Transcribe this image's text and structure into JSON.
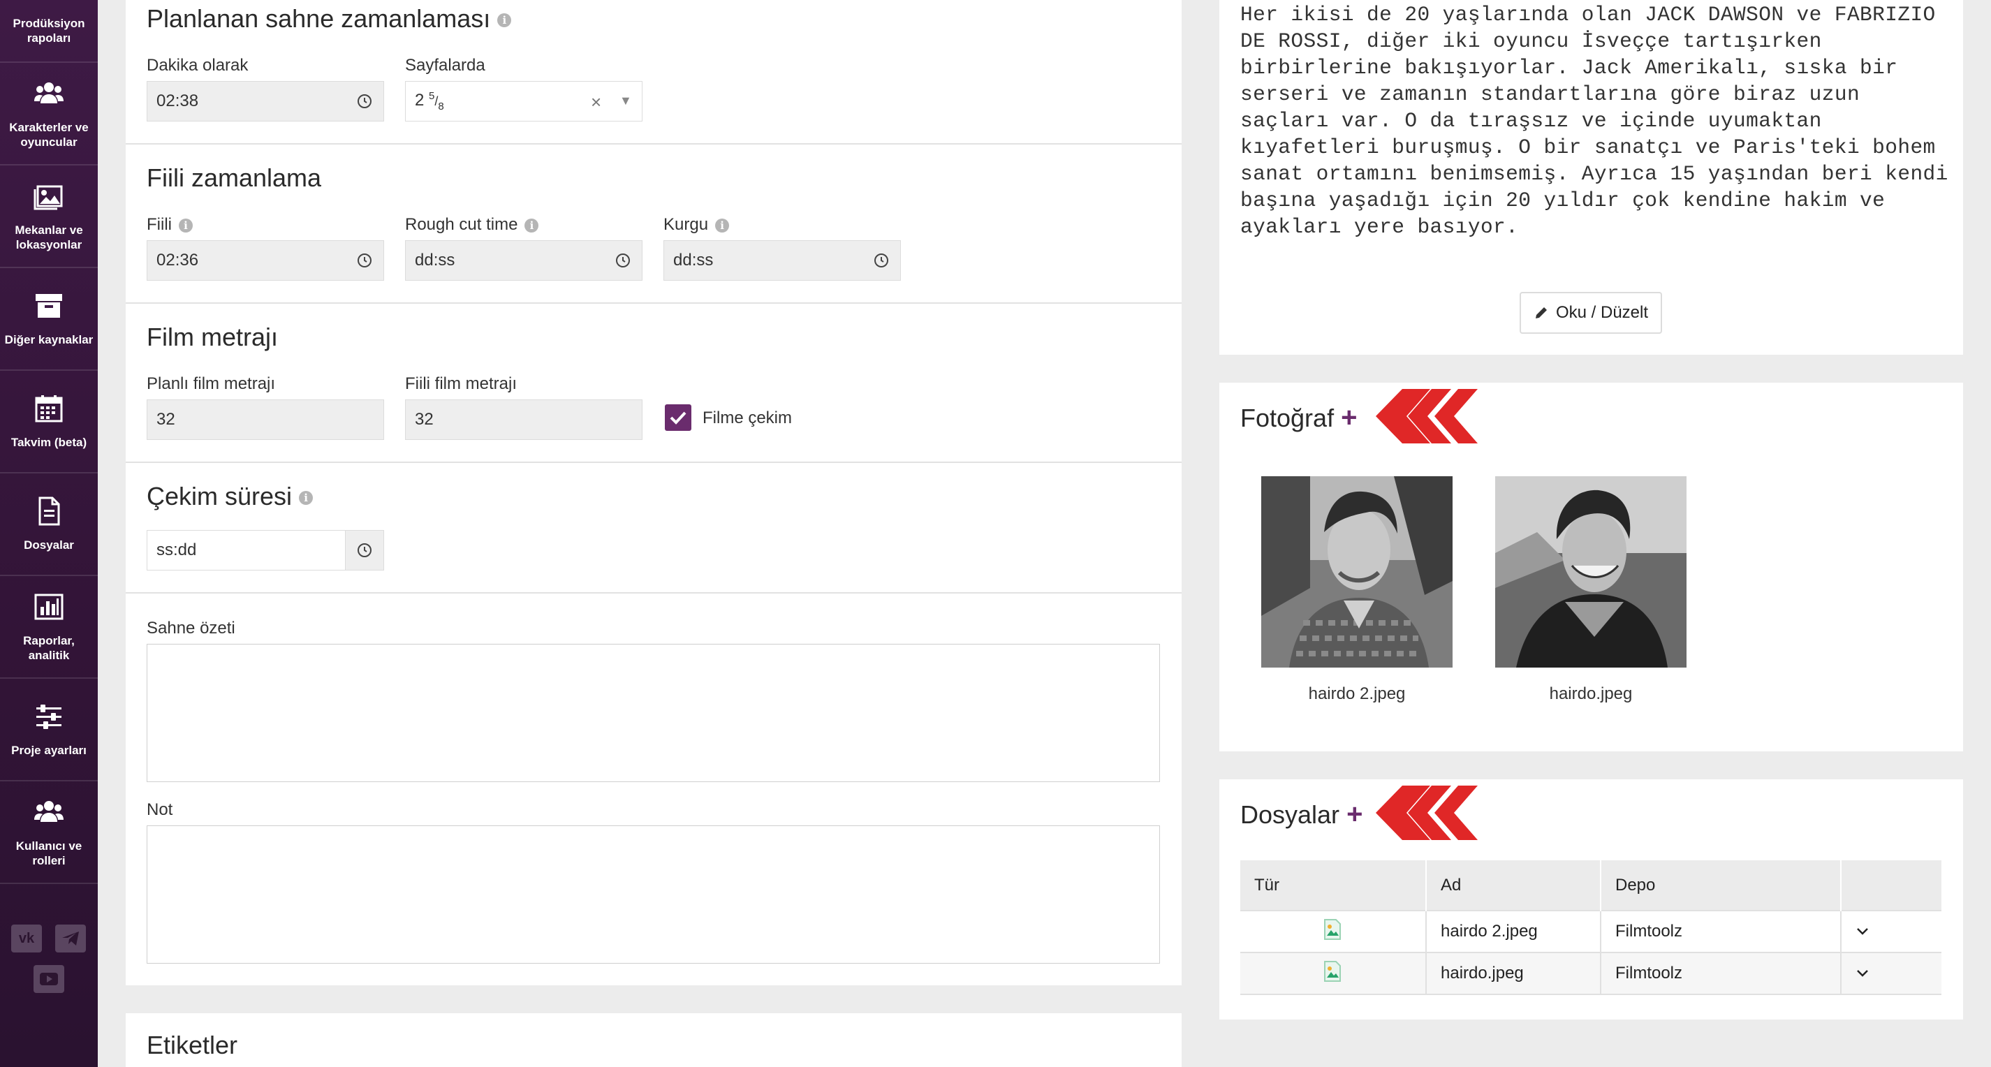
{
  "sidebar": {
    "items": [
      {
        "label": "Prodüksiyon rapoları",
        "icon": "none"
      },
      {
        "label": "Karakterler ve oyuncular",
        "icon": "users-icon"
      },
      {
        "label": "Mekanlar ve lokasyonlar",
        "icon": "image-icon"
      },
      {
        "label": "Diğer kaynaklar",
        "icon": "archive-icon"
      },
      {
        "label": "Takvim (beta)",
        "icon": "calendar-icon"
      },
      {
        "label": "Dosyalar",
        "icon": "file-icon"
      },
      {
        "label": "Raporlar, analitik",
        "icon": "bar-chart-icon"
      },
      {
        "label": "Proje ayarları",
        "icon": "sliders-icon"
      },
      {
        "label": "Kullanıcı ve rolleri",
        "icon": "users-icon"
      }
    ],
    "social": [
      "VK",
      "telegram",
      "youtube"
    ]
  },
  "planned": {
    "title": "Planlanan sahne zamanlaması",
    "minutes_label": "Dakika olarak",
    "minutes_value": "02:38",
    "pages_label": "Sayfalarda",
    "pages_whole": "2",
    "pages_num": "5",
    "pages_slash": "/",
    "pages_den": "8"
  },
  "actual": {
    "title": "Fiili zamanlama",
    "fiili_label": "Fiili",
    "fiili_value": "02:36",
    "rough_label": "Rough cut time",
    "rough_value": "dd:ss",
    "kurgu_label": "Kurgu",
    "kurgu_value": "dd:ss"
  },
  "footage": {
    "title": "Film metrajı",
    "planned_label": "Planlı film metrajı",
    "planned_value": "32",
    "actual_label": "Fiili film metrajı",
    "actual_value": "32",
    "checkbox_label": "Filme çekim",
    "checked": true
  },
  "shoot": {
    "title": "Çekim süresi",
    "value": "ss:dd"
  },
  "summary": {
    "label": "Sahne özeti",
    "value": ""
  },
  "note": {
    "label": "Not",
    "value": ""
  },
  "tags": {
    "title": "Etiketler"
  },
  "description": {
    "text": "Her ikisi de 20 yaşlarında olan JACK DAWSON ve FABRIZIO DE ROSSI, diğer iki oyuncu İsveççe tartışırken birbirlerine bakışıyorlar. Jack Amerikalı, sıska bir serseri ve zamanın standartlarına göre biraz uzun saçları var. O da tıraşsız ve içinde uyumaktan kıyafetleri buruşmuş. O bir sanatçı ve Paris'teki bohem sanat ortamını benimsemiş. Ayrıca 15 yaşından beri kendi başına yaşadığı için 20 yıldır çok kendine hakim ve ayakları yere basıyor.",
    "button": "Oku / Düzelt"
  },
  "photos": {
    "title": "Fotoğraf",
    "plus": "+",
    "items": [
      {
        "caption": "hairdo 2.jpeg"
      },
      {
        "caption": "hairdo.jpeg"
      }
    ]
  },
  "files": {
    "title": "Dosyalar",
    "plus": "+",
    "headers": [
      "Tür",
      "Ad",
      "Depo",
      ""
    ],
    "rows": [
      {
        "type_icon": "image-file-icon",
        "name": "hairdo 2.jpeg",
        "storage": "Filmtoolz"
      },
      {
        "type_icon": "image-file-icon",
        "name": "hairdo.jpeg",
        "storage": "Filmtoolz"
      }
    ]
  },
  "colors": {
    "sidebar": "#3e1a45",
    "accent": "#6a2c6d",
    "brand_red": "#e02727"
  }
}
